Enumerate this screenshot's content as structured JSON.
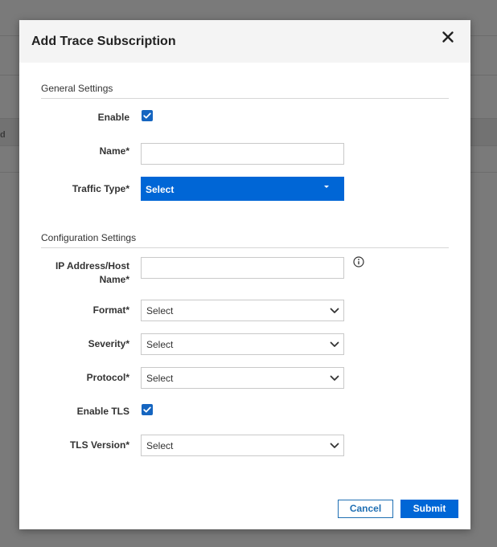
{
  "background": {
    "partial_text": "d"
  },
  "dialog": {
    "title": "Add Trace Subscription",
    "sections": {
      "general": "General Settings",
      "configuration": "Configuration Settings"
    },
    "fields": {
      "enable": {
        "label": "Enable",
        "checked": true
      },
      "name": {
        "label": "Name*",
        "value": ""
      },
      "traffic_type": {
        "label": "Traffic Type*",
        "value": "Select"
      },
      "ip_address": {
        "label_line1": "IP Address/Host",
        "label_line2": "Name*",
        "value": ""
      },
      "format": {
        "label": "Format*",
        "value": "Select"
      },
      "severity": {
        "label": "Severity*",
        "value": "Select"
      },
      "protocol": {
        "label": "Protocol*",
        "value": "Select"
      },
      "enable_tls": {
        "label": "Enable TLS",
        "checked": true
      },
      "tls_version": {
        "label": "TLS Version*",
        "value": "Select"
      }
    },
    "buttons": {
      "cancel": "Cancel",
      "submit": "Submit"
    }
  },
  "colors": {
    "accent": "#0066d6",
    "checkbox": "#1565c0",
    "overlay": "#7a7a7a"
  },
  "icons": {
    "close": "close-icon",
    "info": "info-icon",
    "chevron": "chevron-down-icon",
    "check": "check-icon"
  }
}
